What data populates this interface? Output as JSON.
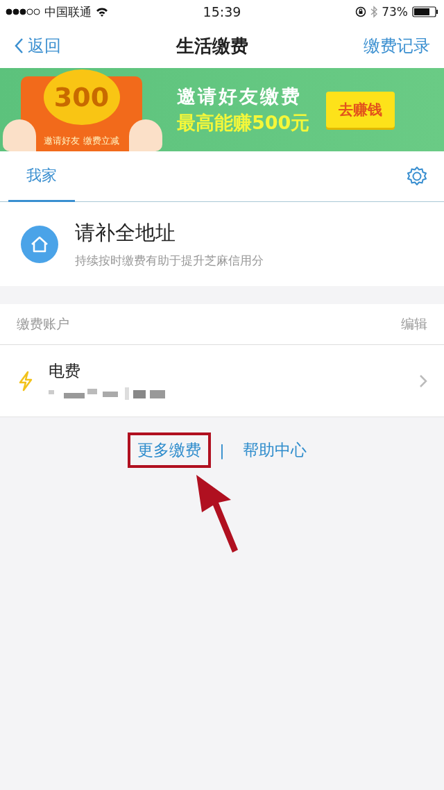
{
  "status_bar": {
    "carrier": "中国联通",
    "time": "15:39",
    "battery": "73%"
  },
  "nav": {
    "back": "返回",
    "title": "生活缴费",
    "action": "缴费记录"
  },
  "banner": {
    "coin": "300",
    "envelope_caption": "邀请好友 缴费立减",
    "headline": "邀请好友缴费",
    "subline": "最高能赚500元",
    "button": "去赚钱"
  },
  "tabs": [
    {
      "label": "我家",
      "selected": true
    }
  ],
  "address": {
    "title": "请补全地址",
    "subtitle": "持续按时缴费有助于提升芝麻信用分"
  },
  "accounts": {
    "header": "缴费账户",
    "edit": "编辑",
    "items": [
      {
        "name": "电费",
        "kind": "electricity"
      }
    ]
  },
  "links": [
    {
      "label": "更多缴费",
      "highlighted": true
    },
    {
      "label": "帮助中心",
      "highlighted": false
    }
  ],
  "separator": "|"
}
